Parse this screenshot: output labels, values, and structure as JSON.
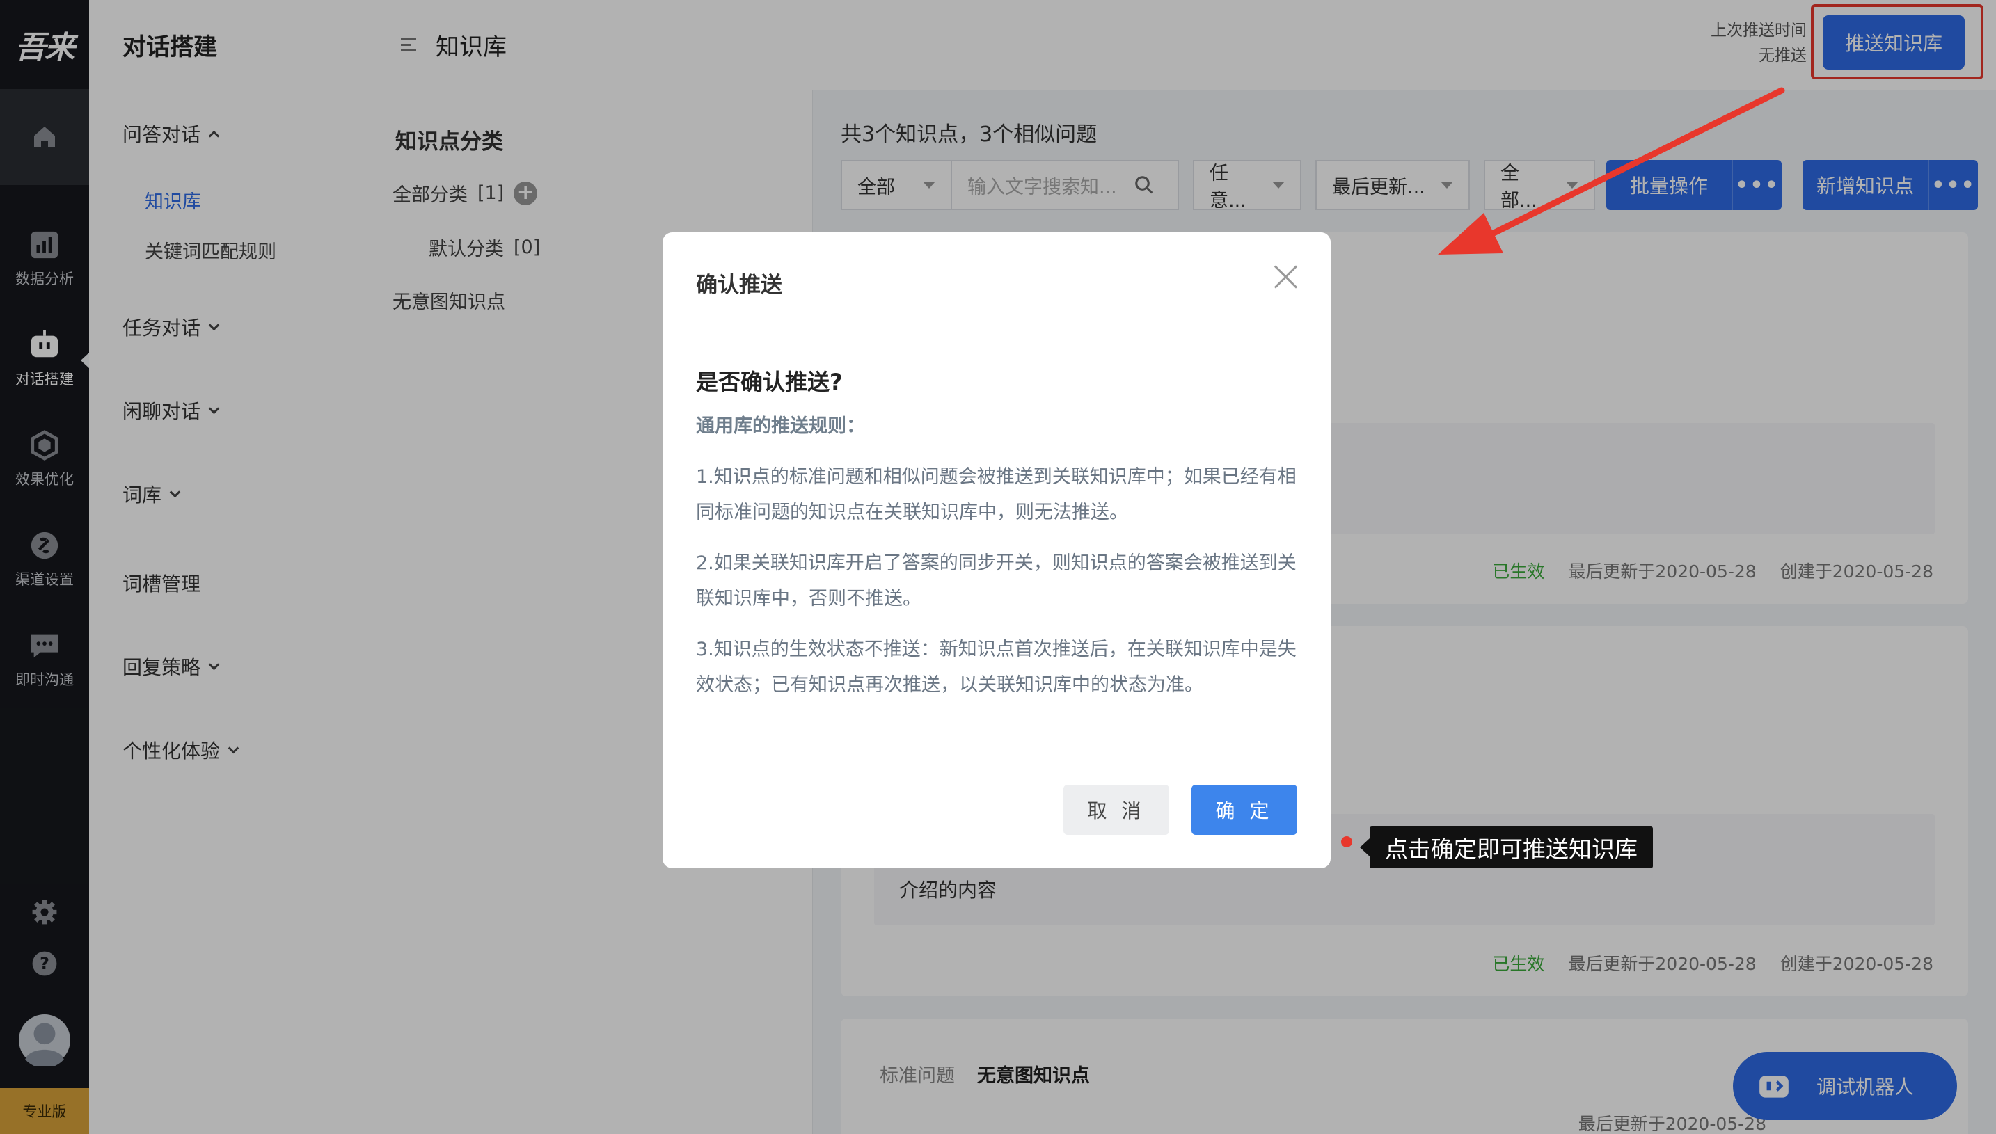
{
  "brand": {
    "logo": "吾来",
    "plan": "专业版"
  },
  "rail": [
    {
      "label": "数据分析",
      "icon": "bar-chart-icon"
    },
    {
      "label": "对话搭建",
      "icon": "robot-icon"
    },
    {
      "label": "效果优化",
      "icon": "cube-icon"
    },
    {
      "label": "渠道设置",
      "icon": "channel-icon"
    },
    {
      "label": "即时沟通",
      "icon": "chat-icon"
    }
  ],
  "menu": {
    "title": "对话搭建",
    "groups": [
      "问答对话",
      "任务对话",
      "闲聊对话",
      "词库",
      "词槽管理",
      "回复策略",
      "个性化体验"
    ],
    "sub": [
      "知识库",
      "关键词匹配规则"
    ]
  },
  "header": {
    "title": "知识库",
    "push_time_label": "上次推送时间",
    "push_time_value": "无推送",
    "push_button": "推送知识库"
  },
  "categories": {
    "title": "知识点分类",
    "all": "全部分类",
    "all_count": "[1]",
    "default": "默认分类",
    "default_count": "[0]",
    "no_intent": "无意图知识点"
  },
  "main": {
    "summary": "共3个知识点，3个相似问题",
    "filter_all": "全部",
    "search_placeholder": "输入文字搜索知...",
    "filter_any": "任意...",
    "filter_sort": "最后更新...",
    "filter_all2": "全部...",
    "batch_button": "批量操作",
    "add_button": "新增知识点",
    "more": "•••"
  },
  "cards": [
    {
      "status": "已生效",
      "updated": "最后更新于2020-05-28",
      "created": "创建于2020-05-28"
    },
    {
      "answer": "介绍的内容",
      "status": "已生效",
      "updated": "最后更新于2020-05-28",
      "created": "创建于2020-05-28"
    },
    {
      "q_label": "标准问题",
      "q_text": "无意图知识点",
      "updated": "最后更新于2020-05-28"
    }
  ],
  "debug_button": "调试机器人",
  "dialog": {
    "title": "确认推送",
    "question": "是否确认推送?",
    "rules_title": "通用库的推送规则：",
    "p1": "1.知识点的标准问题和相似问题会被推送到关联知识库中；如果已经有相同标准问题的知识点在关联知识库中，则无法推送。",
    "p2": "2.如果关联知识库开启了答案的同步开关，则知识点的答案会被推送到关联知识库中，否则不推送。",
    "p3": "3.知识点的生效状态不推送：新知识点首次推送后，在关联知识库中是失效状态；已有知识点再次推送，以关联知识库中的状态为准。",
    "cancel": "取 消",
    "ok": "确 定"
  },
  "tooltip": "点击确定即可推送知识库",
  "colors": {
    "primary": "#2e6be6",
    "annotation": "#e8372c",
    "success": "#3aaa3a"
  }
}
